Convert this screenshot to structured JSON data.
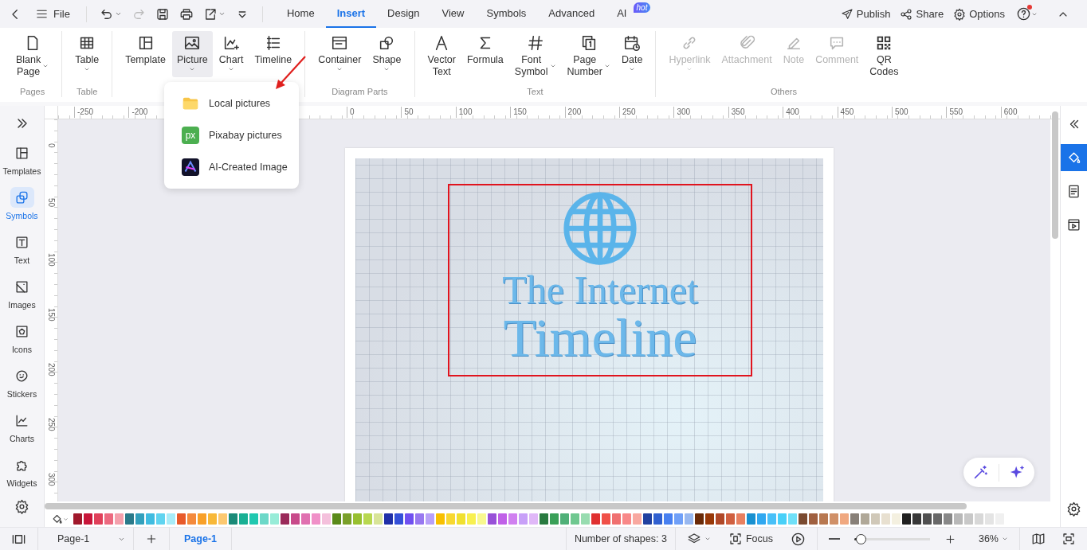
{
  "topbar": {
    "file_label": "File",
    "quick_tools": [
      {
        "caret": true,
        "disabled": false
      },
      {
        "caret": false,
        "disabled": true
      },
      {
        "caret": false,
        "disabled": false
      },
      {
        "caret": false,
        "disabled": false
      },
      {
        "caret": true,
        "disabled": false
      },
      {
        "caret": false,
        "disabled": false
      }
    ],
    "tabs": [
      {
        "label": "Home",
        "selected": false
      },
      {
        "label": "Insert",
        "selected": true
      },
      {
        "label": "Design",
        "selected": false
      },
      {
        "label": "View",
        "selected": false
      },
      {
        "label": "Symbols",
        "selected": false
      },
      {
        "label": "Advanced",
        "selected": false
      },
      {
        "label": "AI",
        "selected": false,
        "badge": "hot"
      }
    ],
    "actions": [
      {
        "label": "Publish"
      },
      {
        "label": "Share"
      },
      {
        "label": "Options"
      }
    ],
    "help": {
      "alert_dot": true
    }
  },
  "ribbon": {
    "groups": [
      {
        "label": "Pages",
        "items": [
          {
            "label": "Blank\nPage",
            "caret": true,
            "caret_beside": true,
            "expanded": false,
            "disabled": false
          }
        ]
      },
      {
        "label": "Table",
        "items": [
          {
            "label": "Table",
            "caret": true,
            "caret_beside": false,
            "expanded": false,
            "disabled": false
          }
        ]
      },
      {
        "items": [
          {
            "label": "Template",
            "caret": false,
            "expanded": false,
            "disabled": false
          },
          {
            "label": "Picture",
            "caret": true,
            "caret_beside": false,
            "expanded": true,
            "disabled": false
          },
          {
            "label": "Chart",
            "caret": true,
            "caret_beside": false,
            "expanded": false,
            "disabled": false
          },
          {
            "label": "Timeline",
            "caret": false,
            "expanded": false,
            "disabled": false
          }
        ]
      },
      {
        "label": "Diagram Parts",
        "items": [
          {
            "label": "Container",
            "caret": true,
            "caret_beside": false,
            "expanded": false,
            "disabled": false
          },
          {
            "label": "Shape",
            "caret": true,
            "caret_beside": false,
            "expanded": false,
            "disabled": false
          }
        ]
      },
      {
        "label": "Text",
        "items": [
          {
            "label": "Vector\nText",
            "caret": false,
            "expanded": false,
            "disabled": false
          },
          {
            "label": "Formula",
            "caret": false,
            "expanded": false,
            "disabled": false
          },
          {
            "label": "Font\nSymbol",
            "caret": true,
            "caret_beside": true,
            "expanded": false,
            "disabled": false
          },
          {
            "label": "Page\nNumber",
            "caret": true,
            "caret_beside": true,
            "expanded": false,
            "disabled": false
          },
          {
            "label": "Date",
            "caret": true,
            "caret_beside": false,
            "expanded": false,
            "disabled": false
          }
        ]
      },
      {
        "label": "Others",
        "items": [
          {
            "label": "Hyperlink",
            "caret": true,
            "caret_beside": false,
            "expanded": false,
            "disabled": true
          },
          {
            "label": "Attachment",
            "caret": false,
            "expanded": false,
            "disabled": true
          },
          {
            "label": "Note",
            "caret": false,
            "expanded": false,
            "disabled": true
          },
          {
            "label": "Comment",
            "caret": false,
            "expanded": false,
            "disabled": true
          },
          {
            "label": "QR\nCodes",
            "caret": false,
            "expanded": false,
            "disabled": false
          }
        ]
      }
    ]
  },
  "picture_menu": {
    "items": [
      {
        "kind": "folder",
        "label": "Local pictures"
      },
      {
        "kind": "badge",
        "badge_text": "px",
        "label": "Pixabay pictures"
      },
      {
        "kind": "ai",
        "label": "AI-Created Image"
      }
    ]
  },
  "rulers": {
    "horizontal": [
      "-250",
      "-200",
      "0",
      "50",
      "100",
      "150",
      "200",
      "250",
      "300",
      "350",
      "400",
      "450",
      "500",
      "550",
      "600"
    ],
    "vertical": [
      "0",
      "50",
      "100",
      "150",
      "200",
      "250",
      "300"
    ]
  },
  "sidebar": {
    "items": [
      {
        "label": "Templates",
        "selected": false
      },
      {
        "label": "Symbols",
        "selected": true
      },
      {
        "label": "Text",
        "selected": false
      },
      {
        "label": "Images",
        "selected": false
      },
      {
        "label": "Icons",
        "selected": false
      },
      {
        "label": "Stickers",
        "selected": false
      },
      {
        "label": "Charts",
        "selected": false
      },
      {
        "label": "Widgets",
        "selected": false
      }
    ]
  },
  "right_panel": {
    "items": [
      {
        "selected": true
      },
      {
        "selected": false
      },
      {
        "selected": false
      }
    ]
  },
  "canvas": {
    "title_lines": [
      "The Internet",
      "Timeline"
    ]
  },
  "palette": [
    {
      "color": "#a0182b"
    },
    {
      "color": "#c8163a"
    },
    {
      "color": "#e0405a"
    },
    {
      "color": "#ec6a80"
    },
    {
      "color": "#f4a0ac"
    },
    {
      "color": "#2a7a8a"
    },
    {
      "color": "#32a0bc"
    },
    {
      "color": "#40bce0"
    },
    {
      "color": "#60d4f0"
    },
    {
      "color": "#a8ecf8"
    },
    {
      "color": "#e85a2a"
    },
    {
      "color": "#f48a3c"
    },
    {
      "color": "#f8a028"
    },
    {
      "color": "#f8b838"
    },
    {
      "color": "#fcc870"
    },
    {
      "color": "#1a8a78"
    },
    {
      "color": "#18b094"
    },
    {
      "color": "#20c8b0"
    },
    {
      "color": "#6cd8c8"
    },
    {
      "color": "#98ecd8"
    },
    {
      "color": "#9a2a5a"
    },
    {
      "color": "#c84a8a"
    },
    {
      "color": "#e070b0"
    },
    {
      "color": "#f090c8"
    },
    {
      "color": "#f4c0dc"
    },
    {
      "color": "#5a8a1a"
    },
    {
      "color": "#7aa02a"
    },
    {
      "color": "#98c030"
    },
    {
      "color": "#b8d850"
    },
    {
      "color": "#d8e498"
    },
    {
      "color": "#2030a8"
    },
    {
      "color": "#3450d8"
    },
    {
      "color": "#7050f0"
    },
    {
      "color": "#9878f0"
    },
    {
      "color": "#b8a0f8"
    },
    {
      "color": "#f8c000"
    },
    {
      "color": "#f8d830"
    },
    {
      "color": "#f0e030"
    },
    {
      "color": "#f8f050"
    },
    {
      "color": "#f8f890"
    },
    {
      "color": "#9850d8"
    },
    {
      "color": "#c060e8"
    },
    {
      "color": "#d080f0"
    },
    {
      "color": "#c8a0f8"
    },
    {
      "color": "#e0b8f8"
    },
    {
      "color": "#287a40"
    },
    {
      "color": "#3aa058"
    },
    {
      "color": "#50b078"
    },
    {
      "color": "#70c890"
    },
    {
      "color": "#98dcb0"
    },
    {
      "color": "#e03030"
    },
    {
      "color": "#f05048"
    },
    {
      "color": "#f07070"
    },
    {
      "color": "#f88888"
    },
    {
      "color": "#f8a8a0"
    },
    {
      "color": "#2040a0"
    },
    {
      "color": "#3060d0"
    },
    {
      "color": "#4880f0"
    },
    {
      "color": "#70a0f8"
    },
    {
      "color": "#98b8f0"
    },
    {
      "color": "#6a2a08"
    },
    {
      "color": "#983808"
    },
    {
      "color": "#b04828"
    },
    {
      "color": "#d06040"
    },
    {
      "color": "#e88060"
    },
    {
      "color": "#1890d0"
    },
    {
      "color": "#30a8f0"
    },
    {
      "color": "#48c0f8"
    },
    {
      "color": "#48d0f8"
    },
    {
      "color": "#70e0f8"
    },
    {
      "color": "#7a4a30"
    },
    {
      "color": "#a06040"
    },
    {
      "color": "#b87850"
    },
    {
      "color": "#d09068"
    },
    {
      "color": "#f0a880"
    },
    {
      "color": "#888078"
    },
    {
      "color": "#b0a898"
    },
    {
      "color": "#d0c8b8"
    },
    {
      "color": "#e8e0d0"
    },
    {
      "color": "#f4f0e0"
    },
    {
      "color": "#202020"
    },
    {
      "color": "#383838"
    },
    {
      "color": "#505050"
    },
    {
      "color": "#686868"
    },
    {
      "color": "#888888"
    },
    {
      "color": "#b8b8b8"
    },
    {
      "color": "#c8c8c8"
    },
    {
      "color": "#d8d8d8"
    },
    {
      "color": "#e4e4e4"
    },
    {
      "color": "#f0f0f0"
    }
  ],
  "status_bar": {
    "page_select": "Page-1",
    "page_tab": "Page-1",
    "shape_count": "Number of shapes: 3",
    "focus": "Focus",
    "zoom": {
      "level": 0.08
    },
    "zoom_value": "36%"
  }
}
